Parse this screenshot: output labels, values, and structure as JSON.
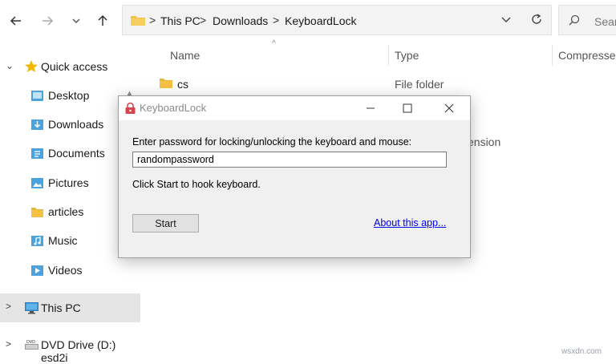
{
  "toolbar": {
    "back_icon": "arrow-left-icon",
    "forward_icon": "arrow-right-icon",
    "recent_icon": "chevron-down-icon",
    "up_icon": "arrow-up-icon"
  },
  "address_bar": {
    "crumbs": [
      "This PC",
      "Downloads",
      "KeyboardLock"
    ]
  },
  "search": {
    "placeholder": "Sear"
  },
  "columns": [
    "Name",
    "Type",
    "Compressed"
  ],
  "files": [
    {
      "name": "cs",
      "type": "File folder"
    }
  ],
  "background_fragments": [
    "ension"
  ],
  "sidebar": {
    "items": [
      {
        "label": "Quick access",
        "icon": "star-icon"
      },
      {
        "label": "Desktop",
        "icon": "desktop-folder-icon"
      },
      {
        "label": "Downloads",
        "icon": "downloads-folder-icon"
      },
      {
        "label": "Documents",
        "icon": "documents-folder-icon"
      },
      {
        "label": "Pictures",
        "icon": "pictures-folder-icon"
      },
      {
        "label": "articles",
        "icon": "folder-icon"
      },
      {
        "label": "Music",
        "icon": "music-folder-icon"
      },
      {
        "label": "Videos",
        "icon": "videos-folder-icon"
      },
      {
        "label": "This PC",
        "icon": "monitor-icon"
      },
      {
        "label": "DVD Drive (D:) esd2i",
        "icon": "dvd-drive-icon"
      }
    ]
  },
  "dialog": {
    "title": "KeyboardLock",
    "prompt": "Enter password for locking/unlocking the keyboard and mouse:",
    "password_value": "randompassword",
    "status": "Click Start to hook keyboard.",
    "start_label": "Start",
    "about_label": "About this app..."
  },
  "watermark": "wsxdn.com",
  "colors": {
    "folder_yellow": "#f5c142",
    "quick_access_star": "#f5b800",
    "selection_bg": "#e5e5e5",
    "link_blue": "#0000ee",
    "dialog_bg": "#f0f0f0",
    "lock_red": "#d9434b"
  }
}
